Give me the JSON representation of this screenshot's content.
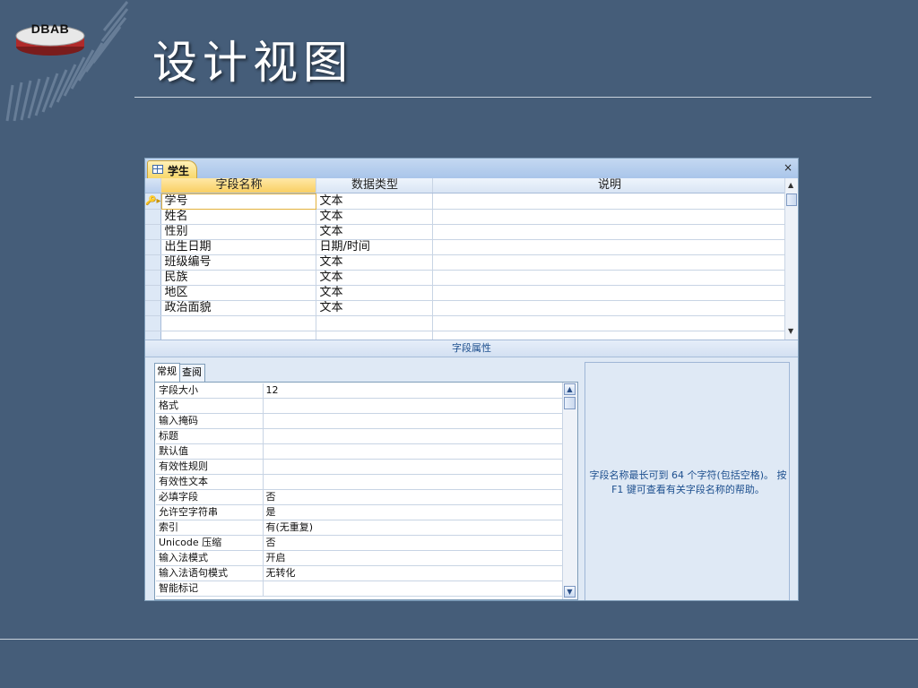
{
  "logo": {
    "text": "DBAB"
  },
  "slide": {
    "title": "设计视图"
  },
  "window": {
    "tab_label": "学生",
    "close_glyph": "×",
    "columns": [
      "字段名称",
      "数据类型",
      "说明"
    ],
    "rows": [
      {
        "name": "学号",
        "type": "文本",
        "desc": "",
        "primary_key": true
      },
      {
        "name": "姓名",
        "type": "文本",
        "desc": ""
      },
      {
        "name": "性别",
        "type": "文本",
        "desc": ""
      },
      {
        "name": "出生日期",
        "type": "日期/时间",
        "desc": ""
      },
      {
        "name": "班级编号",
        "type": "文本",
        "desc": ""
      },
      {
        "name": "民族",
        "type": "文本",
        "desc": ""
      },
      {
        "name": "地区",
        "type": "文本",
        "desc": ""
      },
      {
        "name": "政治面貌",
        "type": "文本",
        "desc": ""
      },
      {
        "name": "",
        "type": "",
        "desc": ""
      },
      {
        "name": "",
        "type": "",
        "desc": ""
      }
    ],
    "properties_header": "字段属性",
    "prop_tabs": [
      "常规",
      "查阅"
    ],
    "properties": [
      {
        "name": "字段大小",
        "value": "12"
      },
      {
        "name": "格式",
        "value": ""
      },
      {
        "name": "输入掩码",
        "value": ""
      },
      {
        "name": "标题",
        "value": ""
      },
      {
        "name": "默认值",
        "value": ""
      },
      {
        "name": "有效性规则",
        "value": ""
      },
      {
        "name": "有效性文本",
        "value": ""
      },
      {
        "name": "必填字段",
        "value": "否"
      },
      {
        "name": "允许空字符串",
        "value": "是"
      },
      {
        "name": "索引",
        "value": "有(无重复)"
      },
      {
        "name": "Unicode 压缩",
        "value": "否"
      },
      {
        "name": "输入法模式",
        "value": "开启"
      },
      {
        "name": "输入法语句模式",
        "value": "无转化"
      },
      {
        "name": "智能标记",
        "value": ""
      }
    ],
    "help_text": "字段名称最长可到 64 个字符(包括空格)。 按 F1 键可查看有关字段名称的帮助。"
  },
  "colors": {
    "background": "#455d79",
    "tab_active": "#f8d86b",
    "help_text": "#1d4f8e"
  }
}
